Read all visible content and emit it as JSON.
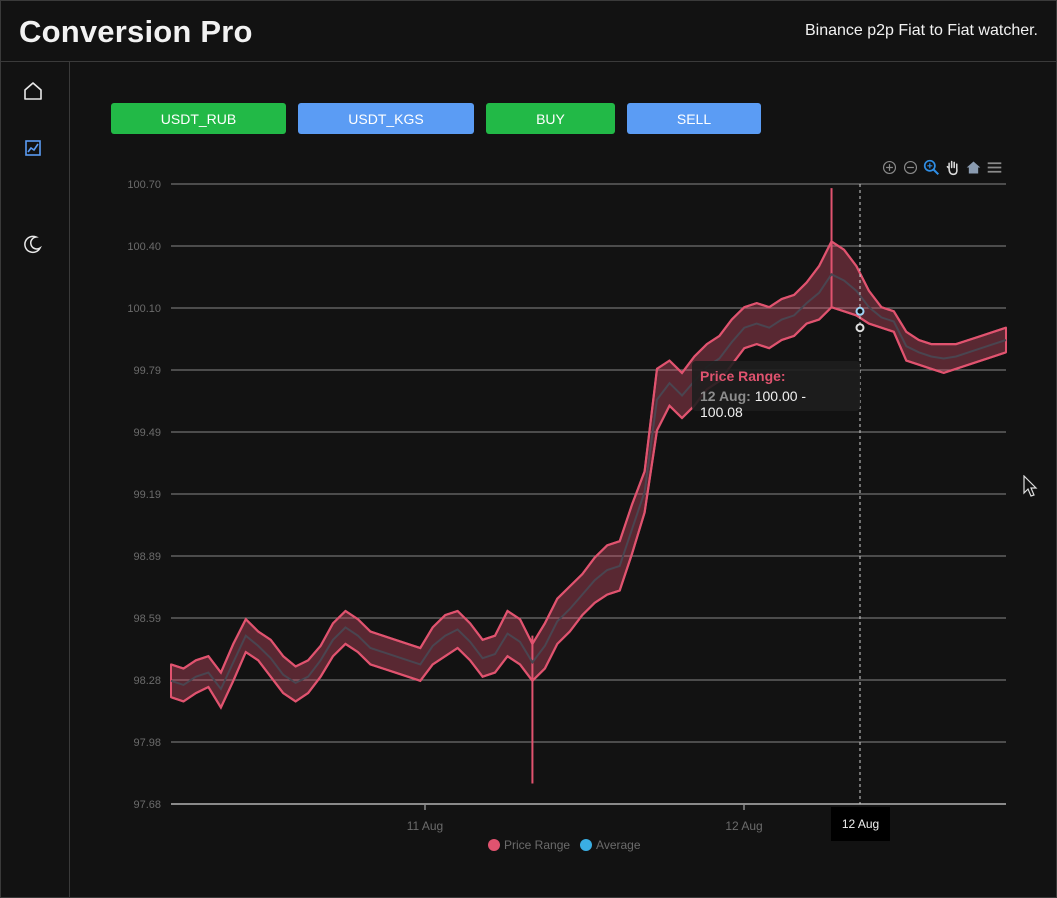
{
  "header": {
    "title": "Conversion Pro",
    "subtitle": "Binance p2p Fiat to Fiat watcher."
  },
  "sidebar": {
    "items": [
      {
        "icon": "home-icon"
      },
      {
        "icon": "chart-icon",
        "active": true
      },
      {
        "icon": "moon-icon"
      }
    ]
  },
  "controls": {
    "pair_rub": "USDT_RUB",
    "pair_kgs": "USDT_KGS",
    "buy": "BUY",
    "sell": "SELL"
  },
  "colors": {
    "green": "#22b947",
    "blue": "#5b9cf4",
    "range": "#e0536f",
    "average": "#3aaee3"
  },
  "toolbar": {
    "icons": [
      "zoom-in-icon",
      "zoom-out-icon",
      "selection-zoom-icon",
      "pan-hand-icon",
      "reset-home-icon",
      "menu-icon"
    ]
  },
  "tooltip": {
    "title": "Price Range:",
    "date": "12 Aug:",
    "value": "100.00 - 100.08"
  },
  "crosshair_label": "12 Aug",
  "chart_data": {
    "type": "area",
    "title": "",
    "xlabel": "",
    "ylabel": "",
    "ylim": [
      97.68,
      100.7
    ],
    "y_ticks": [
      "100.70",
      "100.40",
      "100.10",
      "99.79",
      "99.49",
      "99.19",
      "98.89",
      "98.59",
      "98.28",
      "97.98",
      "97.68"
    ],
    "x_ticks": [
      "11 Aug",
      "12 Aug"
    ],
    "legend": [
      "Price Range",
      "Average"
    ],
    "legend_position": "bottom",
    "grid": true,
    "series": [
      {
        "name": "Price Range",
        "type": "rangeArea",
        "points": [
          [
            0,
            98.2,
            98.36
          ],
          [
            1,
            98.18,
            98.34
          ],
          [
            2,
            98.22,
            98.38
          ],
          [
            3,
            98.25,
            98.4
          ],
          [
            4,
            98.15,
            98.32
          ],
          [
            5,
            98.28,
            98.46
          ],
          [
            6,
            98.42,
            98.58
          ],
          [
            7,
            98.38,
            98.52
          ],
          [
            8,
            98.3,
            98.48
          ],
          [
            9,
            98.22,
            98.4
          ],
          [
            10,
            98.18,
            98.35
          ],
          [
            11,
            98.22,
            98.38
          ],
          [
            12,
            98.3,
            98.45
          ],
          [
            13,
            98.4,
            98.56
          ],
          [
            14,
            98.46,
            98.62
          ],
          [
            15,
            98.42,
            98.58
          ],
          [
            16,
            98.36,
            98.52
          ],
          [
            17,
            98.34,
            98.5
          ],
          [
            18,
            98.32,
            98.48
          ],
          [
            19,
            98.3,
            98.46
          ],
          [
            20,
            98.28,
            98.44
          ],
          [
            21,
            98.36,
            98.54
          ],
          [
            22,
            98.4,
            98.6
          ],
          [
            23,
            98.44,
            98.62
          ],
          [
            24,
            98.38,
            98.56
          ],
          [
            25,
            98.3,
            98.48
          ],
          [
            26,
            98.32,
            98.5
          ],
          [
            27,
            98.4,
            98.62
          ],
          [
            28,
            98.36,
            98.58
          ],
          [
            29,
            98.28,
            98.46
          ],
          [
            30,
            98.34,
            98.56
          ],
          [
            31,
            98.46,
            98.68
          ],
          [
            32,
            98.52,
            98.74
          ],
          [
            33,
            98.6,
            98.8
          ],
          [
            34,
            98.66,
            98.88
          ],
          [
            35,
            98.7,
            98.94
          ],
          [
            36,
            98.72,
            98.96
          ],
          [
            37,
            98.9,
            99.14
          ],
          [
            38,
            99.1,
            99.3
          ],
          [
            39,
            99.5,
            99.8
          ],
          [
            40,
            99.62,
            99.84
          ],
          [
            41,
            99.56,
            99.78
          ],
          [
            42,
            99.62,
            99.86
          ],
          [
            43,
            99.7,
            99.92
          ],
          [
            44,
            99.74,
            99.96
          ],
          [
            45,
            99.82,
            100.04
          ],
          [
            46,
            99.9,
            100.1
          ],
          [
            47,
            99.92,
            100.12
          ],
          [
            48,
            99.9,
            100.1
          ],
          [
            49,
            99.94,
            100.14
          ],
          [
            50,
            99.96,
            100.16
          ],
          [
            51,
            100.02,
            100.22
          ],
          [
            52,
            100.04,
            100.3
          ],
          [
            53,
            100.1,
            100.42
          ],
          [
            54,
            100.08,
            100.38
          ],
          [
            55,
            100.06,
            100.3
          ],
          [
            56,
            100.02,
            100.18
          ],
          [
            57,
            100.0,
            100.1
          ],
          [
            58,
            99.98,
            100.08
          ],
          [
            59,
            99.84,
            99.98
          ],
          [
            60,
            99.82,
            99.94
          ],
          [
            61,
            99.8,
            99.92
          ],
          [
            62,
            99.78,
            99.92
          ],
          [
            63,
            99.8,
            99.92
          ],
          [
            64,
            99.82,
            99.94
          ],
          [
            65,
            99.84,
            99.96
          ],
          [
            66,
            99.86,
            99.98
          ],
          [
            67,
            99.88,
            100.0
          ]
        ]
      },
      {
        "name": "Average",
        "type": "line",
        "values": [
          98.28,
          98.26,
          98.3,
          98.32,
          98.24,
          98.37,
          98.5,
          98.45,
          98.39,
          98.31,
          98.27,
          98.3,
          98.38,
          98.48,
          98.54,
          98.5,
          98.44,
          98.42,
          98.4,
          98.38,
          98.36,
          98.45,
          98.5,
          98.53,
          98.47,
          98.39,
          98.41,
          98.51,
          98.47,
          98.37,
          98.45,
          98.57,
          98.63,
          98.7,
          98.77,
          98.82,
          98.84,
          99.02,
          99.2,
          99.65,
          99.73,
          99.67,
          99.74,
          99.81,
          99.85,
          99.93,
          100.0,
          100.02,
          100.0,
          100.04,
          100.06,
          100.12,
          100.17,
          100.26,
          100.23,
          100.18,
          100.1,
          100.05,
          100.03,
          99.91,
          99.88,
          99.86,
          99.85,
          99.86,
          99.88,
          99.9,
          99.92,
          99.94
        ]
      }
    ],
    "spikes": [
      {
        "x": 29,
        "low": 97.78
      },
      {
        "x": 53,
        "high": 100.68
      }
    ]
  }
}
